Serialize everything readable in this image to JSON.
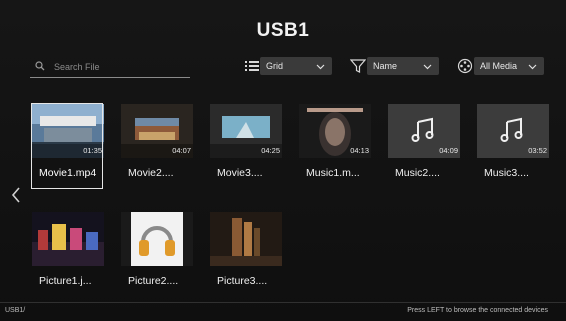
{
  "header": {
    "title": "USB1"
  },
  "search": {
    "placeholder": "Search File"
  },
  "filters": {
    "view": "Grid",
    "sort": "Name",
    "media": "All Media"
  },
  "items": [
    {
      "label": "Movie1.mp4",
      "duration": "01:35",
      "kind": "movie",
      "selected": true
    },
    {
      "label": "Movie2....",
      "duration": "04:07",
      "kind": "movie"
    },
    {
      "label": "Movie3....",
      "duration": "04:25",
      "kind": "movie"
    },
    {
      "label": "Music1.m...",
      "duration": "04:13",
      "kind": "music-album"
    },
    {
      "label": "Music2....",
      "duration": "04:09",
      "kind": "music"
    },
    {
      "label": "Music3....",
      "duration": "03:52",
      "kind": "music"
    },
    {
      "label": "Picture1.j...",
      "kind": "picture"
    },
    {
      "label": "Picture2....",
      "kind": "picture"
    },
    {
      "label": "Picture3....",
      "kind": "picture"
    }
  ],
  "footer": {
    "path": "USB1/",
    "hint": "Press LEFT to browse the connected devices"
  },
  "colors": {
    "background": "#121212",
    "dropdown": "#3a3a3a",
    "music_tile": "#3c3c3c"
  },
  "icons": [
    "search-icon",
    "grid-view-icon",
    "filter-icon",
    "media-reel-icon",
    "chevron-down-icon",
    "music-note-icon",
    "left-arrow-icon"
  ]
}
